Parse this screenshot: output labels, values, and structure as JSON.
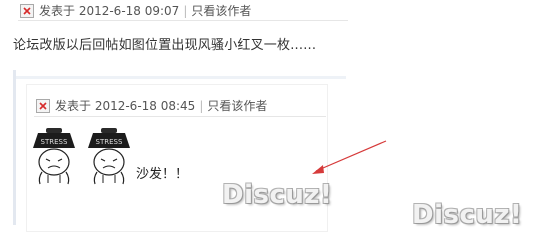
{
  "post": {
    "avatar_icon": "broken-image-icon",
    "posted_on": "发表于 2012-6-18 09:07",
    "only_author": "只看该作者",
    "content": "论坛改版以后回帖如图位置出现风骚小红叉一枚......"
  },
  "quote": {
    "avatar_icon": "broken-image-icon",
    "posted_on": "发表于 2012-6-18 08:45",
    "only_author": "只看该作者",
    "emoticon_label": "STRESS",
    "content": "沙发！！"
  },
  "watermarks": [
    "Discuz!",
    "Discuz!"
  ],
  "annotation": {
    "color": "#d63a3a"
  }
}
